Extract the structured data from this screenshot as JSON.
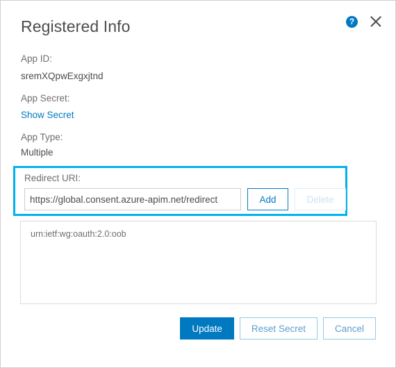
{
  "dialog": {
    "title": "Registered Info",
    "help_icon_glyph": "?",
    "help_icon_name": "help-icon",
    "close_icon_name": "close-icon"
  },
  "fields": {
    "app_id_label": "App ID:",
    "app_id_value": "sremXQpwExgxjtnd",
    "app_secret_label": "App Secret:",
    "show_secret_link": "Show Secret",
    "app_type_label": "App Type:",
    "app_type_value": "Multiple"
  },
  "redirect": {
    "label": "Redirect URI:",
    "input_value": "https://global.consent.azure-apim.net/redirect",
    "input_placeholder": "",
    "add_label": "Add",
    "delete_label": "Delete",
    "highlight_color": "#00b2ec"
  },
  "uri_list": {
    "items": [
      "urn:ietf:wg:oauth:2.0:oob"
    ]
  },
  "footer": {
    "update_label": "Update",
    "reset_secret_label": "Reset Secret",
    "cancel_label": "Cancel"
  },
  "colors": {
    "accent_blue": "#0079c1",
    "highlight_cyan": "#00b2ec",
    "secondary_blue": "#5a9fd0",
    "label_gray": "#6e6e6e",
    "value_gray": "#4c4c4c"
  }
}
